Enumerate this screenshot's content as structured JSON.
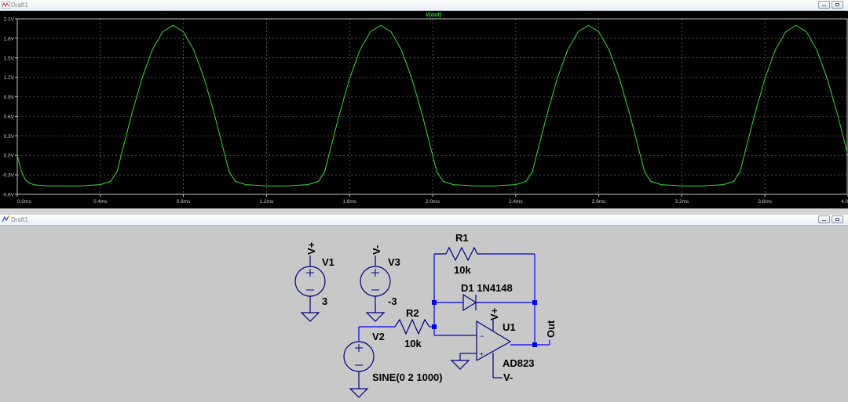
{
  "plot_window": {
    "title": "Draft1",
    "trace_label": "V(out)",
    "trace_color": "#33dd33",
    "background": "#000000",
    "axis_color": "#c8c8c8"
  },
  "schematic_window": {
    "title": "Draft1",
    "background": "#c8c8c8",
    "wire_color": "#0000ff",
    "component_color": "#000080",
    "labels": {
      "v1_pin": "V+",
      "v1_name": "V1",
      "v1_value": "3",
      "v3_pin": "V-",
      "v3_name": "V3",
      "v3_value": "-3",
      "r1_name": "R1",
      "r1_value": "10k",
      "d1_name": "D1 1N4148",
      "r2_name": "R2",
      "r2_value": "10k",
      "v2_name": "V2",
      "v2_value": "SINE(0 2 1000)",
      "u1_pos_pin": "V+",
      "u1_name": "U1",
      "u1_value": "AD823",
      "u1_neg_pin": "V-",
      "out_label": "Out",
      "opamp_minus": "−",
      "opamp_plus": "+"
    }
  },
  "chart_data": {
    "type": "line",
    "title": "V(out)",
    "xlabel": "",
    "ylabel": "",
    "x_ticks": [
      "0.0ms",
      "0.4ms",
      "0.8ms",
      "1.2ms",
      "1.6ms",
      "2.0ms",
      "2.4ms",
      "2.8ms",
      "3.2ms",
      "3.6ms",
      "4.0ms"
    ],
    "y_ticks": [
      "2.1V",
      "1.8V",
      "1.5V",
      "1.2V",
      "0.9V",
      "0.6V",
      "0.3V",
      "0.0V",
      "-0.3V",
      "-0.6V"
    ],
    "xlim": [
      0,
      4.0
    ],
    "ylim": [
      -0.6,
      2.1
    ],
    "grid": true,
    "series": [
      {
        "name": "V(out)",
        "x": [
          0,
          0.02,
          0.04,
          0.06,
          0.08,
          0.1,
          0.15,
          0.2,
          0.3,
          0.4,
          0.45,
          0.48,
          0.5,
          0.55,
          0.6,
          0.65,
          0.7,
          0.75,
          0.8,
          0.85,
          0.9,
          0.95,
          1.0,
          1.02,
          1.05,
          1.1,
          1.2,
          1.3,
          1.4,
          1.45,
          1.48,
          1.5,
          1.55,
          1.6,
          1.65,
          1.7,
          1.75,
          1.8,
          1.85,
          1.9,
          1.95,
          2.0,
          2.02,
          2.05,
          2.1,
          2.2,
          2.3,
          2.4,
          2.45,
          2.48,
          2.5,
          2.55,
          2.6,
          2.65,
          2.7,
          2.75,
          2.8,
          2.85,
          2.9,
          2.95,
          3.0,
          3.02,
          3.05,
          3.1,
          3.2,
          3.3,
          3.4,
          3.45,
          3.48,
          3.5,
          3.55,
          3.6,
          3.65,
          3.7,
          3.75,
          3.8,
          3.85,
          3.9,
          3.95,
          4.0
        ],
        "y": [
          0.0,
          -0.25,
          -0.38,
          -0.43,
          -0.45,
          -0.46,
          -0.47,
          -0.47,
          -0.47,
          -0.45,
          -0.4,
          -0.25,
          0.0,
          0.62,
          1.18,
          1.62,
          1.9,
          2.0,
          1.9,
          1.62,
          1.18,
          0.62,
          0.0,
          -0.25,
          -0.4,
          -0.45,
          -0.47,
          -0.47,
          -0.45,
          -0.4,
          -0.25,
          0.0,
          0.62,
          1.18,
          1.62,
          1.9,
          2.0,
          1.9,
          1.62,
          1.18,
          0.62,
          0.0,
          -0.25,
          -0.4,
          -0.45,
          -0.47,
          -0.47,
          -0.45,
          -0.4,
          -0.25,
          0.0,
          0.62,
          1.18,
          1.62,
          1.9,
          2.0,
          1.9,
          1.62,
          1.18,
          0.62,
          0.0,
          -0.25,
          -0.4,
          -0.45,
          -0.47,
          -0.47,
          -0.45,
          -0.4,
          -0.25,
          0.0,
          0.62,
          1.18,
          1.62,
          1.9,
          2.0,
          1.9,
          1.62,
          1.18,
          0.62,
          0.0
        ]
      }
    ]
  }
}
